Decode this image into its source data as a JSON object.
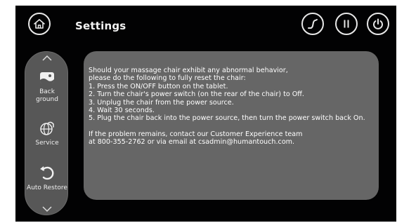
{
  "header": {
    "title": "Settings",
    "icons": [
      "home-icon",
      "stretch-icon",
      "pause-icon",
      "power-icon"
    ]
  },
  "sidebar": {
    "items": [
      {
        "label": "Back\nground",
        "icon": "background-icon"
      },
      {
        "label": "Service",
        "icon": "service-globe-icon"
      },
      {
        "label": "Auto Restore",
        "icon": "auto-restore-icon"
      }
    ]
  },
  "message": {
    "paragraph1": [
      "Should your massage chair exhibit any abnormal behavior,",
      "please do the following to fully reset the chair:",
      "1. Press the ON/OFF button on the tablet.",
      "2. Turn the chair's power switch (on the rear of the chair) to Off.",
      "3. Unplug the chair from the power source.",
      "4. Wait 30 seconds.",
      "5. Plug the chair back into the power source, then turn the power switch back On."
    ],
    "paragraph2": [
      "If the problem remains, contact our Customer Experience team",
      "at 800-355-2762 or via email at csadmin@humantouch.com."
    ]
  }
}
